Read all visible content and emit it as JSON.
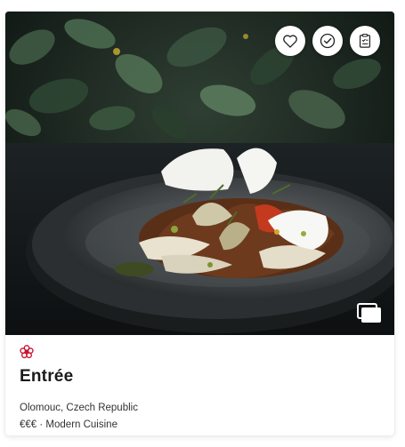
{
  "card": {
    "name": "Entrée",
    "location": "Olomouc, Czech Republic",
    "price": "€€€",
    "separator": " · ",
    "cuisine": "Modern Cuisine",
    "distinction_icon": "michelin-flower-icon",
    "distinction_color": "#c8102e"
  },
  "actions": {
    "favorite_icon": "heart-icon",
    "visited_icon": "check-circle-icon",
    "list_icon": "clipboard-list-icon"
  },
  "gallery_icon": "gallery-icon"
}
